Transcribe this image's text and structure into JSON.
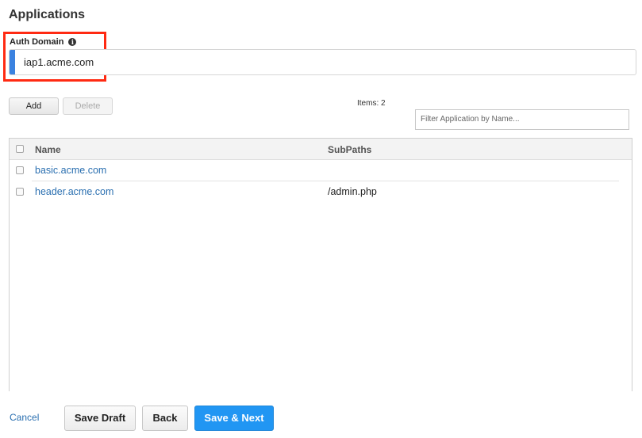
{
  "page": {
    "title": "Applications"
  },
  "auth_domain": {
    "label": "Auth Domain",
    "info_icon": "info-icon",
    "value": "iap1.acme.com"
  },
  "toolbar": {
    "add_label": "Add",
    "delete_label": "Delete",
    "items_count": "Items: 2",
    "filter_placeholder": "Filter Application by Name..."
  },
  "table": {
    "columns": [
      "Name",
      "SubPaths"
    ],
    "rows": [
      {
        "name": "basic.acme.com",
        "subpaths": ""
      },
      {
        "name": "header.acme.com",
        "subpaths": "/admin.php"
      }
    ]
  },
  "footer": {
    "cancel_label": "Cancel",
    "save_draft_label": "Save Draft",
    "back_label": "Back",
    "save_next_label": "Save & Next"
  },
  "colors": {
    "accent": "#2196f3",
    "highlight": "#ff2a12",
    "link": "#2a6fb0"
  }
}
